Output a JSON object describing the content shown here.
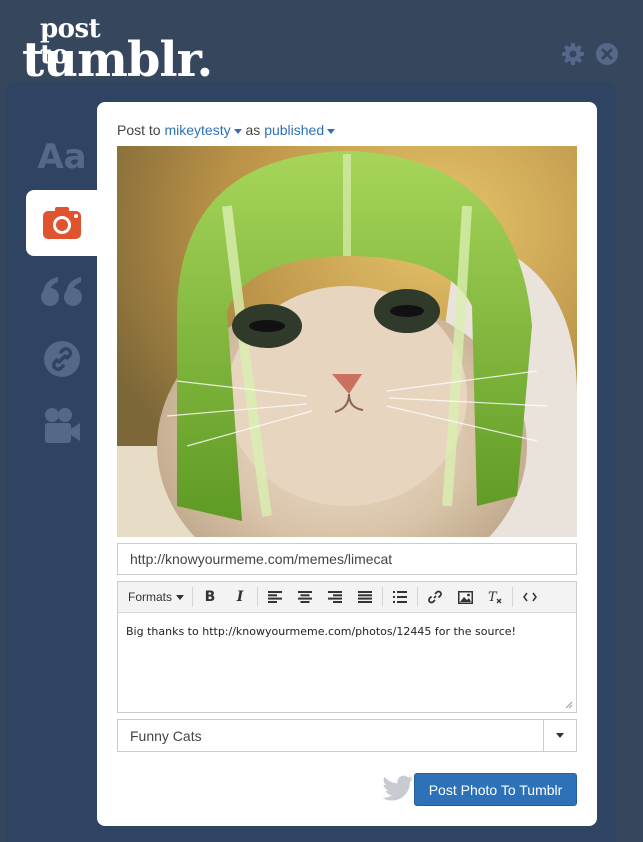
{
  "brand": {
    "line1": "post to",
    "line2": "tumblr."
  },
  "header_icons": [
    "gear-icon",
    "close-icon"
  ],
  "sidebar": {
    "items": [
      {
        "name": "text",
        "label": "Aa",
        "icon": "text-icon"
      },
      {
        "name": "photo",
        "icon": "camera-icon",
        "active": true
      },
      {
        "name": "quote",
        "icon": "quote-icon"
      },
      {
        "name": "link",
        "icon": "link-icon"
      },
      {
        "name": "video",
        "icon": "video-camera-icon"
      }
    ]
  },
  "post_to": {
    "prefix": "Post to",
    "blog": "mikeytesty",
    "middle": "as",
    "state": "published"
  },
  "photo": {
    "description_icon": "cat-with-lime-helmet-photo"
  },
  "source_url": {
    "value": "http://knowyourmeme.com/memes/limecat"
  },
  "editor": {
    "formats_label": "Formats",
    "body": "Big thanks to http://knowyourmeme.com/photos/12445 for the source!"
  },
  "tags_select": {
    "value": "Funny Cats"
  },
  "actions": {
    "post_label": "Post Photo To Tumblr"
  },
  "colors": {
    "background": "#36465d",
    "accent": "#2d72b8",
    "camera": "#e0532f"
  }
}
